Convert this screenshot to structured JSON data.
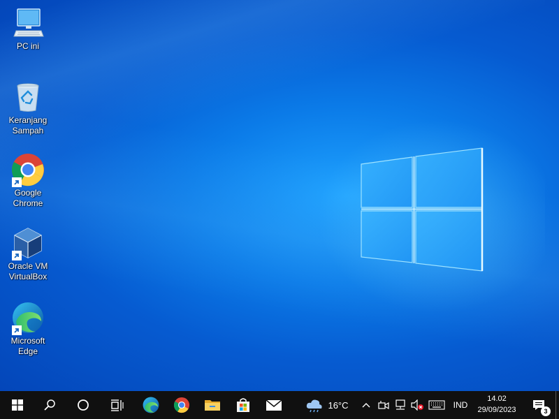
{
  "desktop_icons": [
    {
      "label": "PC ini"
    },
    {
      "label": "Keranjang\nSampah"
    },
    {
      "label": "Google\nChrome"
    },
    {
      "label": "Oracle VM\nVirtualBox"
    },
    {
      "label": "Microsoft\nEdge"
    }
  ],
  "taskbar": {
    "start_icon": "windows-start-icon",
    "search_icon": "search-icon",
    "cortana_icon": "cortana-circle-icon",
    "task_view_icon": "task-view-icon",
    "pinned": [
      "edge-icon",
      "chrome-icon",
      "file-explorer-icon",
      "microsoft-store-icon",
      "mail-icon"
    ]
  },
  "tray": {
    "weather_temp": "16°C",
    "language": "IND",
    "time": "14.02",
    "date": "29/09/2023",
    "notifications_count": "3",
    "muted": true
  },
  "colors": {
    "accent": "#0b7be8",
    "taskbar": "#101010",
    "logo_glow": "#7fd4ff"
  }
}
